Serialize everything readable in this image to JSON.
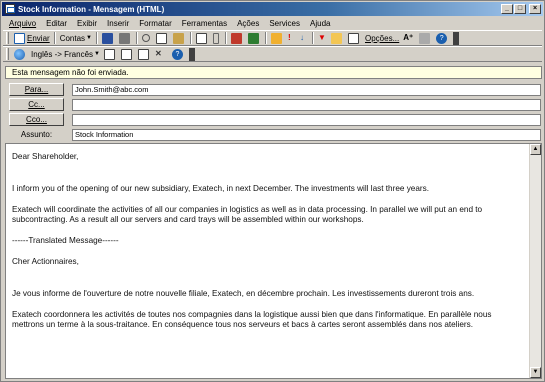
{
  "window": {
    "title": "Stock Information - Mensagem (HTML)",
    "controls": {
      "minimize": "_",
      "maximize": "□",
      "close": "×"
    }
  },
  "menu": {
    "items": [
      "Arquivo",
      "Editar",
      "Exibir",
      "Inserir",
      "Formatar",
      "Ferramentas",
      "Ações",
      "Services",
      "Ajuda"
    ]
  },
  "toolbar1": {
    "send": "Enviar",
    "contacts": "Contas",
    "options": "Opções...",
    "font_glyph": "A⁺",
    "help_glyph": "?"
  },
  "toolbar2": {
    "translation": "Inglês -> Francês",
    "help_glyph": "?"
  },
  "infobar": {
    "text": "Esta mensagem não foi enviada."
  },
  "headers": {
    "to_label": "Para...",
    "to_value": "John.Smith@abc.com",
    "cc_label": "Cc...",
    "cc_value": "",
    "bcc_label": "Cco...",
    "bcc_value": "",
    "subject_label": "Assunto:",
    "subject_value": "Stock Information"
  },
  "body": {
    "p1": "Dear Shareholder,",
    "p2": "I inform you of the opening of our new subsidiary, Exatech, in next December. The investments will last three years.",
    "p3": "Exatech will coordinate the activities of all our companies in logistics as well as in data processing. In parallel we will put an end to subcontracting. As a result all our servers and card trays will be assembled within our workshops.",
    "p4": "------Translated Message------",
    "p5": "Cher Actionnaires,",
    "p6": "Je vous informe de l'ouverture de notre nouvelle filiale, Exatech, en décembre prochain. Les investissements dureront trois ans.",
    "p7": "Exatech coordonnera les activités de toutes nos compagnies dans la logistique aussi bien que dans l'informatique. En parallèle nous mettrons un terme à la sous-traitance. En conséquence tous nos serveurs et bacs à cartes seront assemblés dans nos ateliers."
  },
  "scrollbar": {
    "up": "▲",
    "down": "▼"
  }
}
